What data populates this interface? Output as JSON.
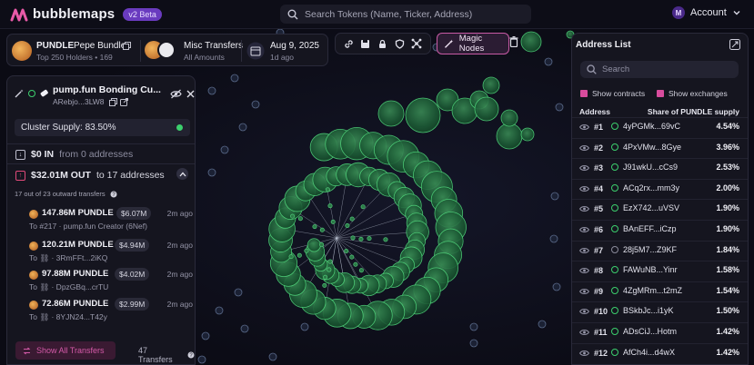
{
  "app": {
    "name": "bubblemaps",
    "version": "v2 Beta"
  },
  "search": {
    "placeholder": "Search Tokens (Name, Ticker, Address)"
  },
  "account": {
    "initial": "M",
    "label": "Account"
  },
  "token": {
    "name": "PUNDLE",
    "full_name": "Pepe Bundle",
    "subtitle": "Top 250 Holders • 169",
    "transfers_title": "Misc Transfers",
    "transfers_sub": "All Amounts",
    "date": "Aug 9, 2025",
    "date_sub": "1d ago"
  },
  "toolbar": {
    "magic_label": "Magic Nodes"
  },
  "cluster": {
    "title": "pump.fun Bonding Cu...",
    "address": "ARebjo...3LW8",
    "supply": "Cluster Supply: 83.50%",
    "in_amount": "$0 IN",
    "in_sub": "from 0 addresses",
    "out_amount": "$32.01M OUT",
    "out_sub": "to 17 addresses",
    "transfers_note": "17 out of 23 outward transfers",
    "transfers": [
      {
        "amount": "147.86M PUNDLE",
        "usd": "$6.07M",
        "time": "2m ago",
        "to": "To #217 · pump.fun Creator (6Nef)"
      },
      {
        "amount": "120.21M PUNDLE",
        "usd": "$4.94M",
        "time": "2m ago",
        "to": "To ⛓ · 3RmFFt...2iKQ"
      },
      {
        "amount": "97.88M PUNDLE",
        "usd": "$4.02M",
        "time": "2m ago",
        "to": "To ⛓ · DpzGBq...crTU"
      },
      {
        "amount": "72.86M PUNDLE",
        "usd": "$2.99M",
        "time": "2m ago",
        "to": "To ⛓ · 8YJN24...T42y"
      }
    ],
    "show_all": "Show All Transfers",
    "count": "47 Transfers"
  },
  "address_list": {
    "title": "Address List",
    "search_placeholder": "Search",
    "show_contracts": "Show contracts",
    "show_exchanges": "Show exchanges",
    "col_address": "Address",
    "col_share": "Share of PUNDLE supply",
    "rows": [
      {
        "rank": "#1",
        "name": "4yPGMk...69vC",
        "pct": "4.54%"
      },
      {
        "rank": "#2",
        "name": "4PxVMw...8Gye",
        "pct": "3.96%"
      },
      {
        "rank": "#3",
        "name": "J91wkU...cCs9",
        "pct": "2.53%"
      },
      {
        "rank": "#4",
        "name": "ACq2rx...mm3y",
        "pct": "2.00%"
      },
      {
        "rank": "#5",
        "name": "EzX742...uVSV",
        "pct": "1.90%"
      },
      {
        "rank": "#6",
        "name": "BAnEFF...iCzp",
        "pct": "1.90%"
      },
      {
        "rank": "#7",
        "name": "28j5M7...Z9KF",
        "pct": "1.84%"
      },
      {
        "rank": "#8",
        "name": "FAWuNB...Yinr",
        "pct": "1.58%"
      },
      {
        "rank": "#9",
        "name": "4ZgMRm...t2mZ",
        "pct": "1.54%"
      },
      {
        "rank": "#10",
        "name": "BSkbJc...i1yK",
        "pct": "1.50%"
      },
      {
        "rank": "#11",
        "name": "ADsCiJ...Hotm",
        "pct": "1.42%"
      },
      {
        "rank": "#12",
        "name": "AfCh4i...d4wX",
        "pct": "1.42%"
      }
    ]
  },
  "colors": {
    "accent": "#6a3bbf",
    "bubble": "#3ccf6d",
    "pink": "#d84c9d"
  }
}
